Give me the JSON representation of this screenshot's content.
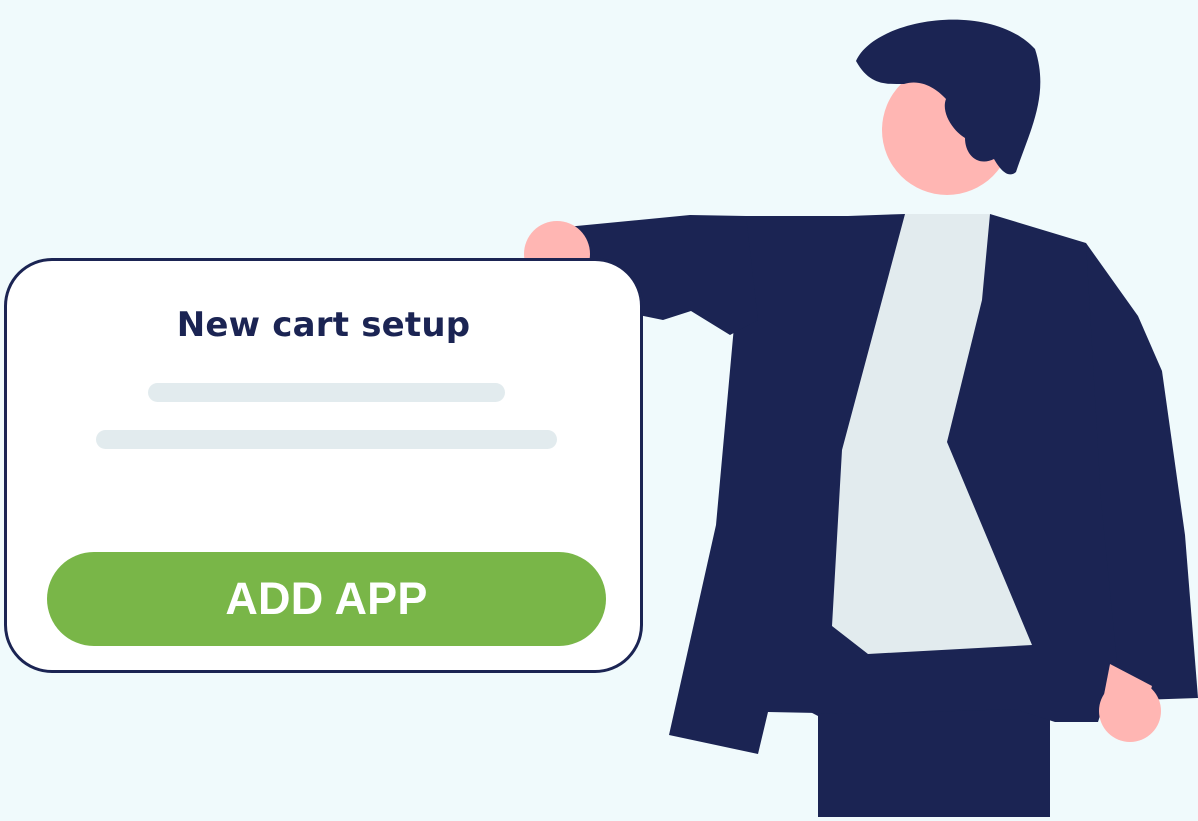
{
  "card": {
    "title": "New cart setup",
    "button_label": "ADD APP"
  },
  "colors": {
    "background": "#f0fafc",
    "navy": "#1b2453",
    "button_green": "#79b648",
    "placeholder_gray": "#e2ebee",
    "skin": "#ffb6b3"
  },
  "illustration": {
    "subject": "man in suit holding card"
  }
}
